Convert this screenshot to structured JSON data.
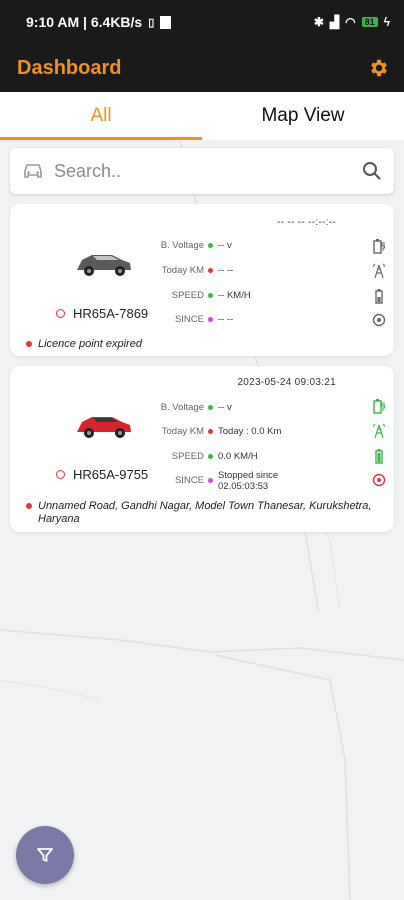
{
  "status_bar": {
    "time_info": "9:10 AM | 6.4KB/s",
    "battery": "81"
  },
  "app_bar": {
    "title": "Dashboard",
    "settings_icon": "gear-icon"
  },
  "tabs": [
    {
      "label": "All",
      "active": true
    },
    {
      "label": "Map View",
      "active": false
    }
  ],
  "search": {
    "placeholder": "Search..",
    "left_icon": "car-icon",
    "right_icon": "search-icon"
  },
  "vehicles": [
    {
      "plate": "HR65A-7869",
      "car_color": "#5a5a5a",
      "timestamp": "-- -- -- --:--:--",
      "voltage_label": "B. Voltage",
      "voltage": "-- v",
      "km_label": "Today KM",
      "km": "-- --",
      "speed_label": "SPEED",
      "speed": "-- KM/H",
      "since_label": "SINCE",
      "since": "-- --",
      "note": "Licence point expired",
      "icon_color": "#666666"
    },
    {
      "plate": "HR65A-9755",
      "car_color": "#d8232a",
      "timestamp": "2023-05-24 09:03:21",
      "voltage_label": "B. Voltage",
      "voltage": "-- v",
      "km_label": "Today KM",
      "km": "Today : 0.0 Km",
      "speed_label": "SPEED",
      "speed": "0.0 KM/H",
      "since_label": "SINCE",
      "since": "Stopped since 02.05:03:53",
      "note": "Unnamed Road, Gandhi Nagar, Model Town Thanesar, Kurukshetra, Haryana",
      "icon_color": "#3cb44b"
    }
  ],
  "colors": {
    "accent": "#f0921c",
    "fab": "#7b7aa6"
  },
  "fab": {
    "icon": "filter-icon"
  }
}
